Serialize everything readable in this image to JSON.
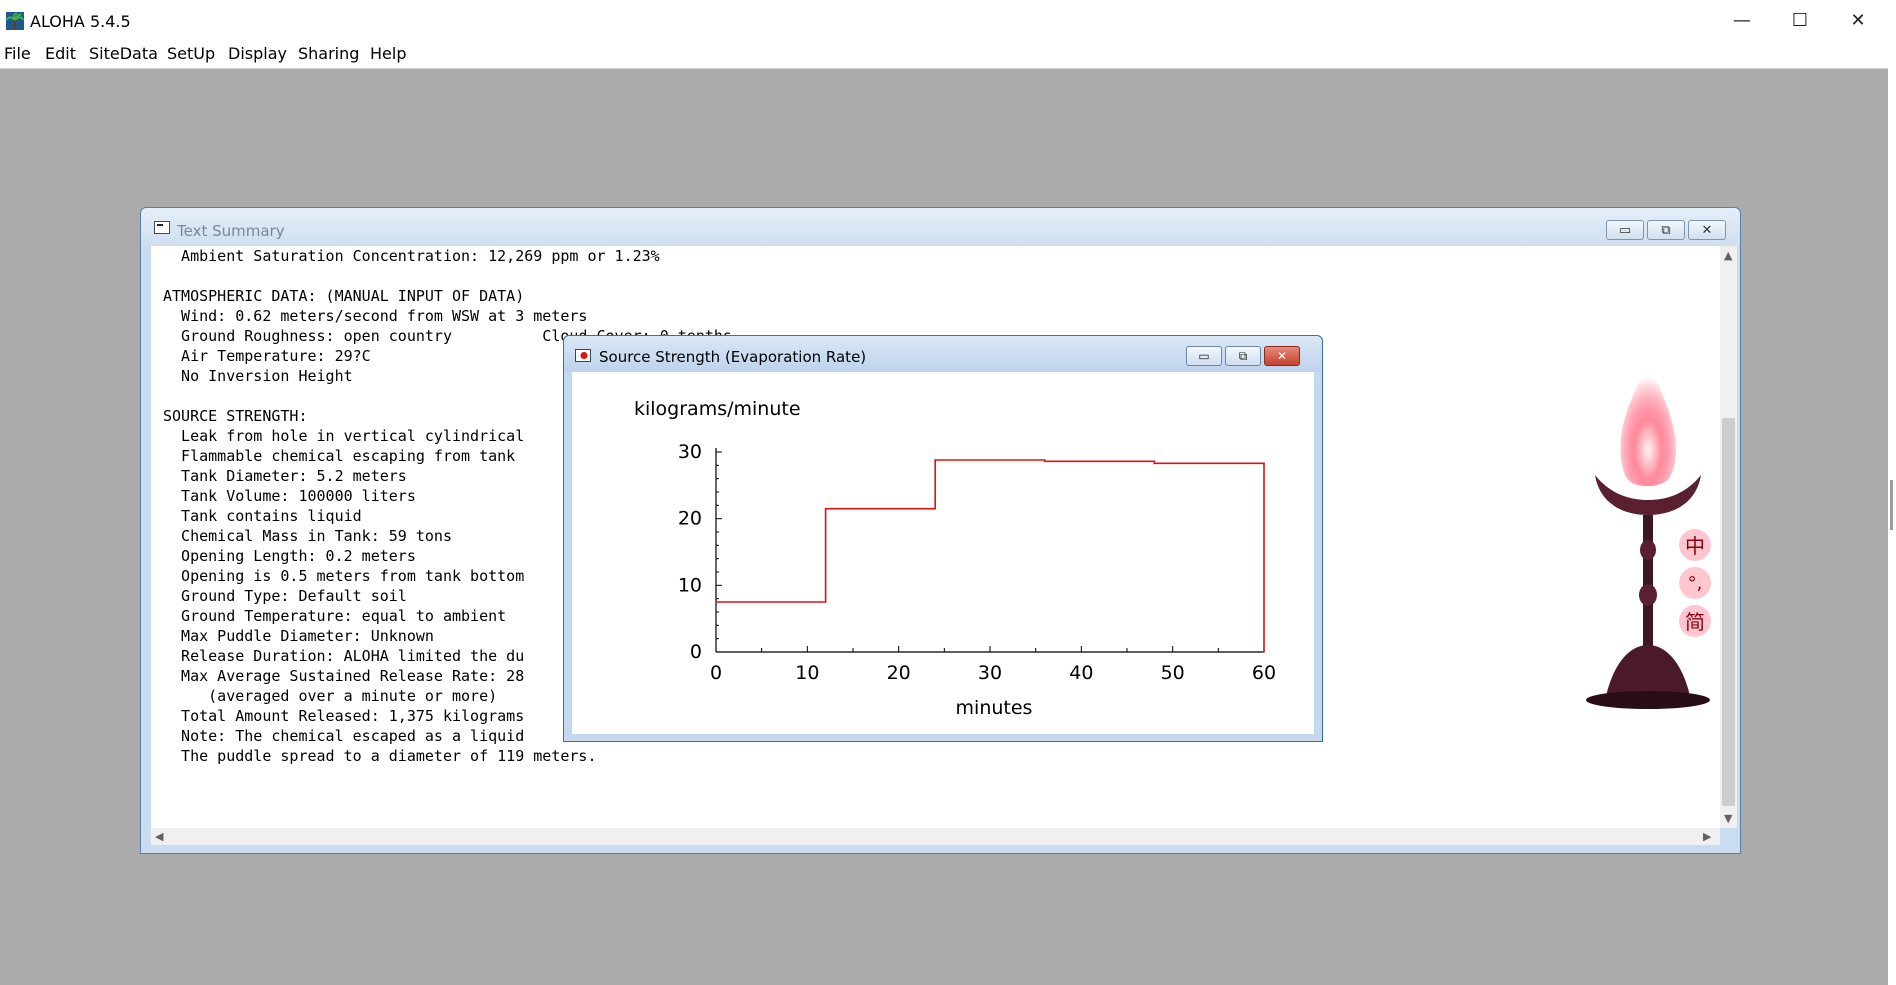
{
  "app": {
    "title": "ALOHA 5.4.5",
    "window_controls": [
      "—",
      "☐",
      "✕"
    ]
  },
  "menu": [
    "File",
    "Edit",
    "SiteData",
    "SetUp",
    "Display",
    "Sharing",
    "Help"
  ],
  "text_summary": {
    "title": "Text Summary",
    "lines": [
      "  Ambient Saturation Concentration: 12,269 ppm or 1.23%",
      "",
      "ATMOSPHERIC DATA: (MANUAL INPUT OF DATA)",
      "  Wind: 0.62 meters/second from WSW at 3 meters",
      "  Ground Roughness: open country          Cloud Cover: 0 tenths",
      "  Air Temperature: 29?C",
      "  No Inversion Height",
      "",
      "SOURCE STRENGTH:",
      "  Leak from hole in vertical cylindrical",
      "  Flammable chemical escaping from tank",
      "  Tank Diameter: 5.2 meters",
      "  Tank Volume: 100000 liters",
      "  Tank contains liquid",
      "  Chemical Mass in Tank: 59 tons",
      "  Opening Length: 0.2 meters",
      "  Opening is 0.5 meters from tank bottom",
      "  Ground Type: Default soil",
      "  Ground Temperature: equal to ambient",
      "  Max Puddle Diameter: Unknown",
      "  Release Duration: ALOHA limited the du",
      "  Max Average Sustained Release Rate: 28",
      "     (averaged over a minute or more)",
      "  Total Amount Released: 1,375 kilograms",
      "  Note: The chemical escaped as a liquid",
      "  The puddle spread to a diameter of 119 meters."
    ]
  },
  "source_strength": {
    "title": "Source Strength (Evaporation Rate)"
  },
  "chart_data": {
    "type": "line",
    "title": "",
    "ylabel": "kilograms/minute",
    "xlabel": "minutes",
    "xlim": [
      0,
      60
    ],
    "ylim": [
      0,
      30
    ],
    "xticks": [
      "0",
      "10",
      "20",
      "30",
      "40",
      "50",
      "60"
    ],
    "yticks": [
      "0",
      "10",
      "20",
      "30"
    ],
    "step": true,
    "x": [
      0,
      12,
      12,
      24,
      24,
      36,
      36,
      48,
      48,
      60,
      60
    ],
    "y": [
      7.5,
      7.5,
      21.5,
      21.5,
      28.8,
      28.8,
      28.6,
      28.6,
      28.3,
      28.3,
      0
    ],
    "line_color": "#e01010",
    "grid": false
  },
  "torch_glyphs": [
    "中",
    "°,",
    "简"
  ]
}
